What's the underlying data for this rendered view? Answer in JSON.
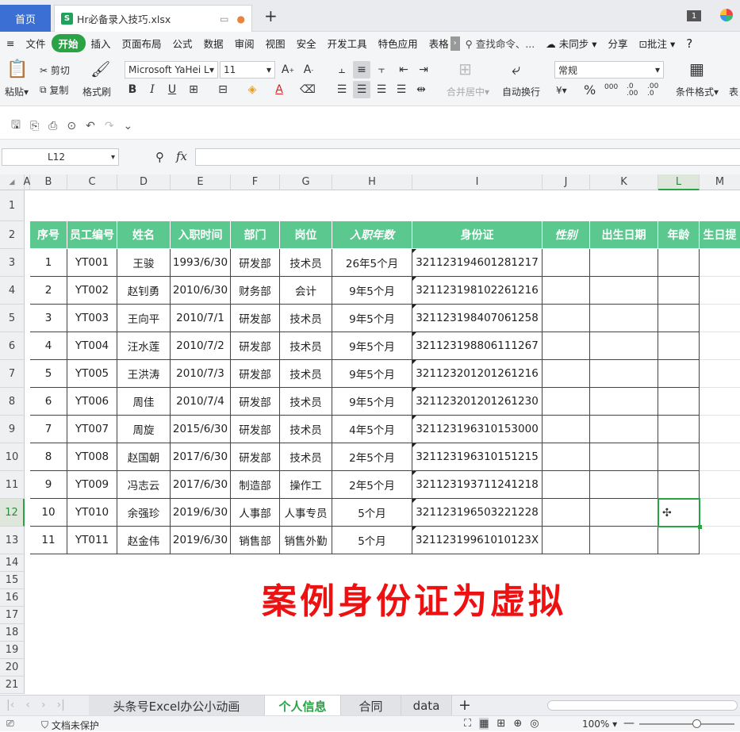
{
  "tabs": {
    "home": "首页",
    "file": "Hr必备录入技巧.xlsx",
    "badge": "1"
  },
  "menu": {
    "file": "文件",
    "items": [
      "开始",
      "插入",
      "页面布局",
      "公式",
      "数据",
      "审阅",
      "视图",
      "安全",
      "开发工具",
      "特色应用",
      "表格"
    ],
    "search": "查找命令、...",
    "sync": "未同步",
    "share": "分享",
    "comment": "批注",
    "help": "?"
  },
  "ribbon": {
    "paste": "粘贴",
    "cut": "剪切",
    "copy": "复制",
    "format_painter": "格式刷",
    "font": "Microsoft YaHei L",
    "size": "11",
    "merge": "合并居中",
    "wrap": "自动换行",
    "number_format": "常规",
    "cond_format": "条件格式",
    "more": "表",
    "bold": "B",
    "italic": "I",
    "underline": "U",
    "pct": "%",
    "dec1": "000",
    "dec2": ".0 .00",
    "dec3": ".00 .0",
    "grow": "A",
    "shrink": "A"
  },
  "formula_bar": {
    "name_box": "L12",
    "fx": "fx",
    "value": ""
  },
  "columns": [
    "A",
    "B",
    "C",
    "D",
    "E",
    "F",
    "G",
    "H",
    "I",
    "J",
    "K",
    "L",
    "M"
  ],
  "rows": [
    "1",
    "2",
    "3",
    "4",
    "5",
    "6",
    "7",
    "8",
    "9",
    "10",
    "11",
    "12",
    "13",
    "14",
    "15",
    "16",
    "17",
    "18",
    "19",
    "20",
    "21"
  ],
  "selected": {
    "col": "L",
    "row": "12"
  },
  "table": {
    "headers": [
      "序号",
      "员工编号",
      "姓名",
      "入职时间",
      "部门",
      "岗位",
      "入职年数",
      "身份证",
      "性别",
      "出生日期",
      "年龄",
      "生日提"
    ],
    "rows": [
      [
        "1",
        "YT001",
        "王骏",
        "1993/6/30",
        "研发部",
        "技术员",
        "26年5个月",
        "321123194601281217"
      ],
      [
        "2",
        "YT002",
        "赵钊勇",
        "2010/6/30",
        "财务部",
        "会计",
        "9年5个月",
        "321123198102261216"
      ],
      [
        "3",
        "YT003",
        "王向平",
        "2010/7/1",
        "研发部",
        "技术员",
        "9年5个月",
        "321123198407061258"
      ],
      [
        "4",
        "YT004",
        "汪水莲",
        "2010/7/2",
        "研发部",
        "技术员",
        "9年5个月",
        "321123198806111267"
      ],
      [
        "5",
        "YT005",
        "王洪涛",
        "2010/7/3",
        "研发部",
        "技术员",
        "9年5个月",
        "321123201201261216"
      ],
      [
        "6",
        "YT006",
        "周佳",
        "2010/7/4",
        "研发部",
        "技术员",
        "9年5个月",
        "321123201201261230"
      ],
      [
        "7",
        "YT007",
        "周旋",
        "2015/6/30",
        "研发部",
        "技术员",
        "4年5个月",
        "321123196310153000"
      ],
      [
        "8",
        "YT008",
        "赵国朝",
        "2017/6/30",
        "研发部",
        "技术员",
        "2年5个月",
        "321123196310151215"
      ],
      [
        "9",
        "YT009",
        "冯志云",
        "2017/6/30",
        "制造部",
        "操作工",
        "2年5个月",
        "321123193711241218"
      ],
      [
        "10",
        "YT010",
        "余强珍",
        "2019/6/30",
        "人事部",
        "人事专员",
        "5个月",
        "321123196503221228"
      ],
      [
        "11",
        "YT011",
        "赵金伟",
        "2019/6/30",
        "销售部",
        "销售外勤",
        "5个月",
        "32112319961010123X"
      ]
    ]
  },
  "overlay_text": "案例身份证为虚拟",
  "sheets": [
    "头条号Excel办公小动画",
    "个人信息",
    "合同",
    "data"
  ],
  "active_sheet": "个人信息",
  "status": {
    "protect": "文档未保护",
    "zoom": "100%"
  },
  "colors": {
    "accent": "#2aa347",
    "header_fill": "#5bc88f",
    "overlay": "#ee1111",
    "home_tab": "#3c6fd4"
  }
}
